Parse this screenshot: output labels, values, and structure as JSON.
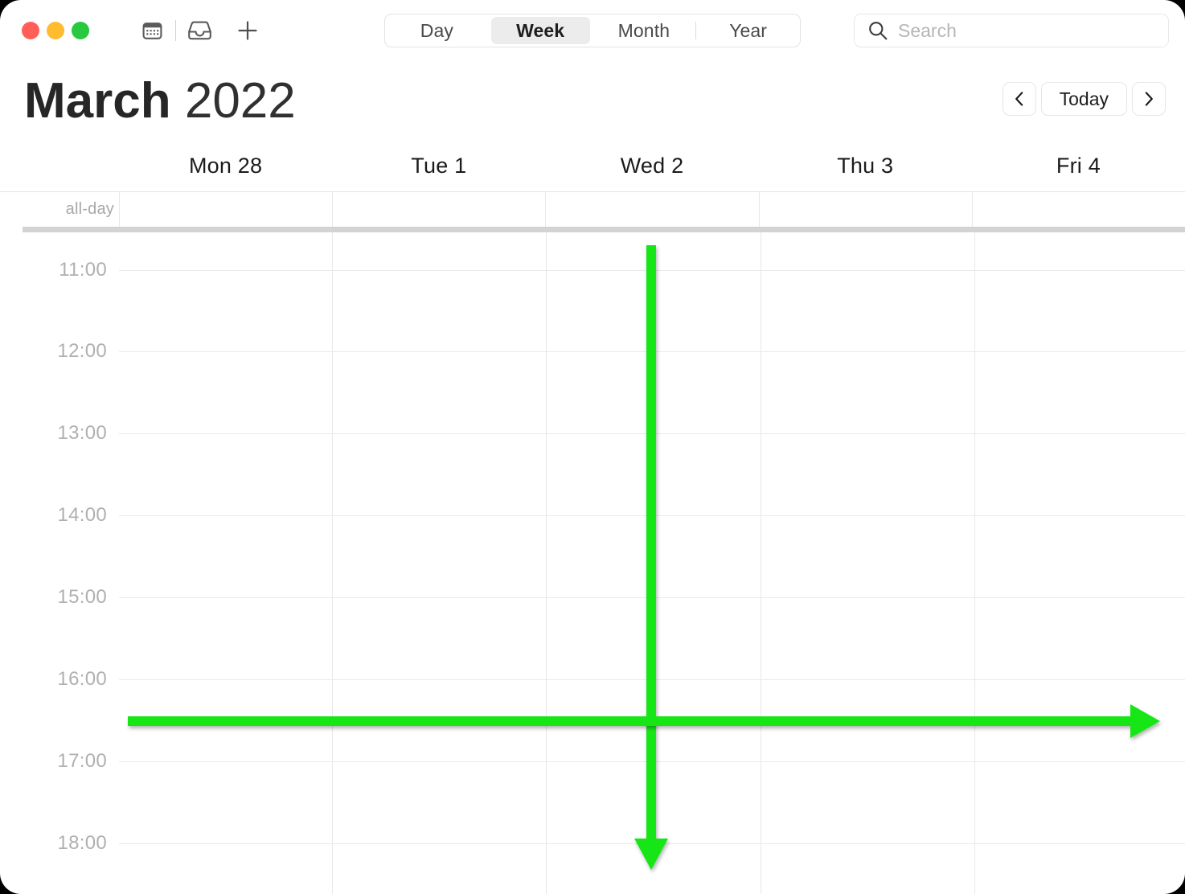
{
  "window": {
    "traffic_lights": [
      {
        "name": "close",
        "color": "#ff5f57"
      },
      {
        "name": "minimize",
        "color": "#febc2e"
      },
      {
        "name": "maximize",
        "color": "#28c840"
      }
    ]
  },
  "toolbar": {
    "icons": [
      {
        "name": "calendar-icon",
        "label": "Calendar"
      },
      {
        "name": "inbox-icon",
        "label": "Inbox"
      },
      {
        "name": "plus-icon",
        "label": "New Event"
      }
    ],
    "segmented": {
      "options": [
        "Day",
        "Week",
        "Month",
        "Year"
      ],
      "selected": "Week"
    },
    "search": {
      "icon": "search-icon",
      "placeholder": "Search",
      "value": ""
    }
  },
  "header": {
    "month": "March",
    "year": "2022",
    "nav": {
      "prev_icon": "chevron-left-icon",
      "today_label": "Today",
      "next_icon": "chevron-right-icon"
    }
  },
  "calendar": {
    "days": [
      "Mon 28",
      "Tue 1",
      "Wed 2",
      "Thu 3",
      "Fri 4"
    ],
    "allday_label": "all-day",
    "hours": [
      "11:00",
      "12:00",
      "13:00",
      "14:00",
      "15:00",
      "16:00",
      "17:00",
      "18:00"
    ]
  },
  "annotations": {
    "color": "#13e616",
    "arrows": [
      {
        "name": "horizontal-arrow",
        "direction": "right",
        "at_time": "16:30"
      },
      {
        "name": "vertical-arrow",
        "direction": "down",
        "at_day": "Wed 2"
      }
    ]
  }
}
